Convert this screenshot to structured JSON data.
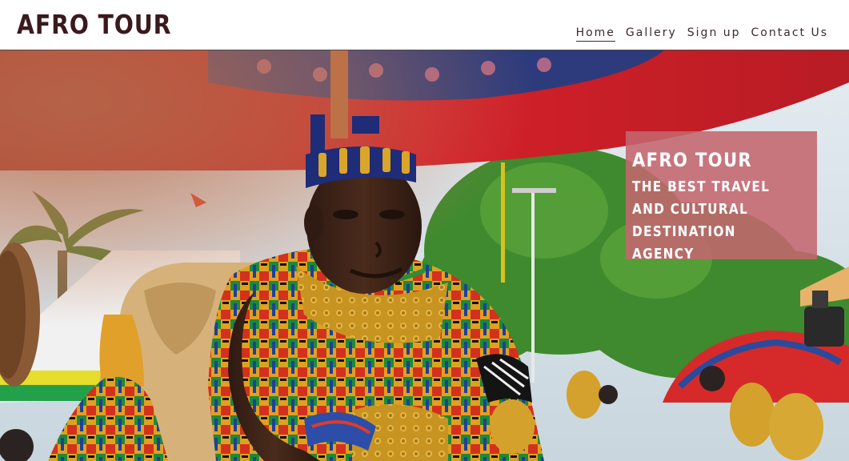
{
  "header": {
    "brand": "AFRO TOUR",
    "nav": [
      {
        "label": "Home",
        "active": true
      },
      {
        "label": "Gallery",
        "active": false
      },
      {
        "label": "Sign up",
        "active": false
      },
      {
        "label": "Contact Us",
        "active": false
      }
    ]
  },
  "hero": {
    "image_subject": "ceremonial-portrait-photo",
    "tagline": {
      "title": "AFRO TOUR",
      "subtitle": "THE BEST TRAVEL AND CULTURAL DESTINATION AGENCY"
    }
  },
  "colors": {
    "brand_text": "#3a1a1d",
    "tagline_box": "#c4666e",
    "nav_text": "#3a2a2a"
  }
}
